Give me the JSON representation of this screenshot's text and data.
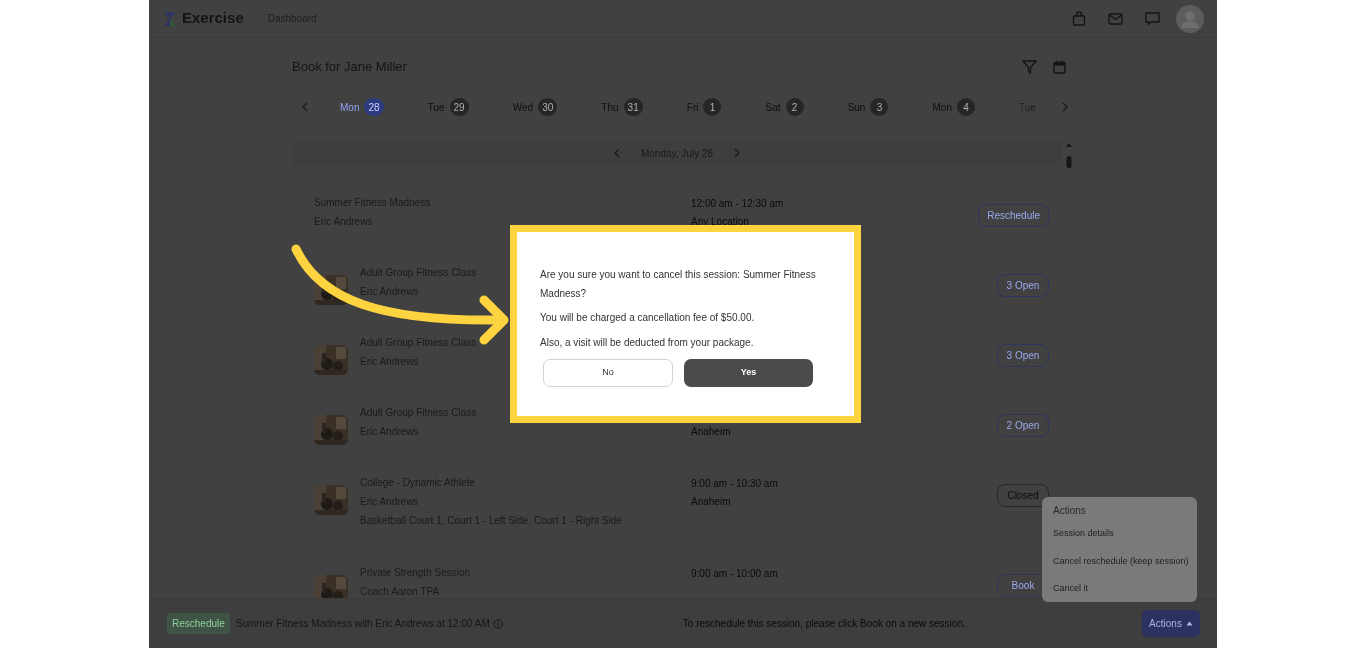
{
  "app": {
    "name": "Exercise",
    "nav_link": "Dashboard"
  },
  "page_title": "Book for Jane Miller",
  "days": [
    {
      "day": "Mon",
      "date": "28",
      "selected": true
    },
    {
      "day": "Tue",
      "date": "29",
      "selected": false
    },
    {
      "day": "Wed",
      "date": "30",
      "selected": false
    },
    {
      "day": "Thu",
      "date": "31",
      "selected": false
    },
    {
      "day": "Fri",
      "date": "1",
      "selected": false
    },
    {
      "day": "Sat",
      "date": "2",
      "selected": false
    },
    {
      "day": "Sun",
      "date": "3",
      "selected": false
    },
    {
      "day": "Mon",
      "date": "4",
      "selected": false
    },
    {
      "day": "Tue",
      "selected": false
    }
  ],
  "current_date": "Monday, July 28",
  "sessions": [
    {
      "kind": "plain",
      "title": "Summer Fitness Madness",
      "instructor": "Eric Andrews",
      "time": "12:00 am - 12:30 am",
      "location": "Any Location",
      "action": "Reschedule"
    },
    {
      "kind": "picture",
      "title": "Adult Group Fitness Class",
      "instructor": "Eric Andrews",
      "action": "3 Open"
    },
    {
      "kind": "picture",
      "title": "Adult Group Fitness Class",
      "instructor": "Eric Andrews",
      "action": "3 Open"
    },
    {
      "kind": "picture",
      "title": "Adult Group Fitness Class",
      "instructor": "Eric Andrews",
      "location": "Anaheim",
      "action": "2 Open"
    },
    {
      "kind": "picture",
      "title": "College - Dynamic Athlete",
      "instructor": "Eric Andrews",
      "courts": "Basketball Court 1, Court 1 - Left Side, Court 1 - Right Side",
      "time": "9:00 am - 10:30 am",
      "location": "Anaheim",
      "action": "Closed"
    },
    {
      "kind": "picture",
      "title": "Private Strength Session",
      "instructor": "Coach Aaron TPA",
      "time": "9:00 am - 10:00 am",
      "action": "Book"
    }
  ],
  "bottom_bar": {
    "tag": "Reschedule",
    "summary": "Summer Fitness Madness with Eric Andrews at 12:00 AM",
    "hint": "To reschedule this session, please click Book on a new session.",
    "actions_button": "Actions"
  },
  "actions_menu": {
    "header": "Actions",
    "items": [
      "Session details",
      "Cancel reschedule (keep session)",
      "Cancel it"
    ]
  },
  "dialog": {
    "lines": [
      "Are you sure you want to cancel this session: Summer Fitness Madness?",
      "You will be charged a cancellation fee of $50.00.",
      "Also, a visit will be deducted from your package."
    ],
    "no_button": "No",
    "yes_button": "Yes"
  }
}
